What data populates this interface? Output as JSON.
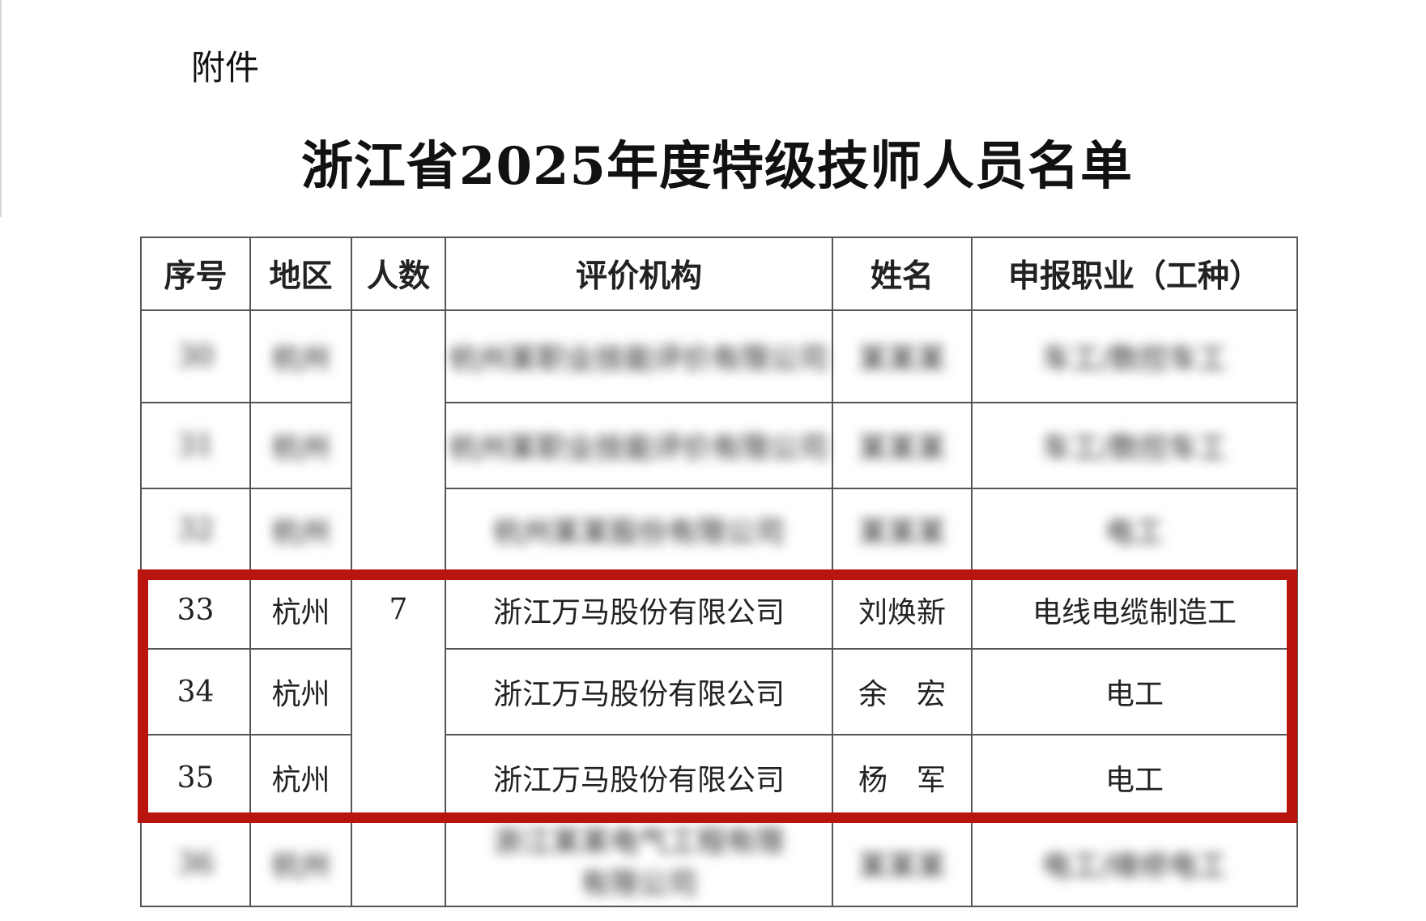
{
  "attachment_label": "附件",
  "title": "浙江省2025年度特级技师人员名单",
  "table": {
    "headers": [
      "序号",
      "地区",
      "人数",
      "评价机构",
      "姓名",
      "申报职业（工种）"
    ],
    "group_count": "7",
    "rows": [
      {
        "no": "30",
        "region": "杭州",
        "org": "杭州某职业技能评价有限公司",
        "name": "某某某",
        "occupation": "车工/数控车工",
        "blurred": true
      },
      {
        "no": "31",
        "region": "杭州",
        "org": "杭州某职业技能评价有限公司",
        "name": "某某某",
        "occupation": "车工/数控车工",
        "blurred": true
      },
      {
        "no": "32",
        "region": "杭州",
        "org": "杭州某某股份有限公司",
        "name": "某某某",
        "occupation": "电工",
        "blurred": true
      },
      {
        "no": "33",
        "region": "杭州",
        "org": "浙江万马股份有限公司",
        "name": "刘焕新",
        "occupation": "电线电缆制造工",
        "blurred": false
      },
      {
        "no": "34",
        "region": "杭州",
        "org": "浙江万马股份有限公司",
        "name": "余　宏",
        "occupation": "电工",
        "blurred": false
      },
      {
        "no": "35",
        "region": "杭州",
        "org": "浙江万马股份有限公司",
        "name": "杨　军",
        "occupation": "电工",
        "blurred": false
      },
      {
        "no": "36",
        "region": "杭州",
        "org_line1": "浙江某某电气工程有限",
        "org_line2": "有限公司",
        "name": "某某某",
        "occupation": "电工/维修电工",
        "blurred": true
      }
    ]
  },
  "highlight_color": "#b8150f"
}
